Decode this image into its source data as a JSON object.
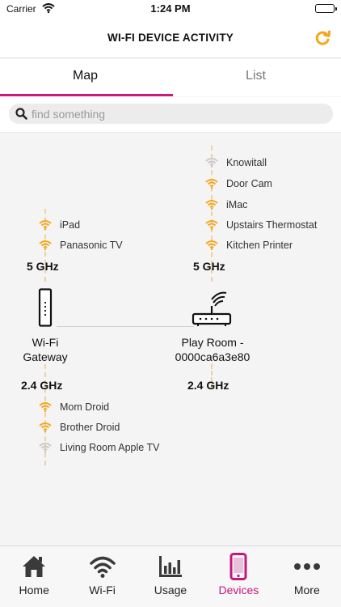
{
  "status": {
    "carrier": "Carrier",
    "time": "1:24 PM"
  },
  "header": {
    "title": "WI-FI DEVICE ACTIVITY"
  },
  "tabs": [
    {
      "label": "Map"
    },
    {
      "label": "List"
    }
  ],
  "search": {
    "placeholder": "find something"
  },
  "map": {
    "gateway": {
      "label_line1": "Wi-Fi",
      "label_line2": "Gateway",
      "band_5": "5 GHz",
      "band_24": "2.4 GHz",
      "devices_5": [
        "iPad",
        "Panasonic TV"
      ],
      "devices_24": [
        "Mom Droid",
        "Brother Droid",
        "Living Room Apple TV"
      ]
    },
    "extender": {
      "label_line1": "Play Room -",
      "label_line2": "0000ca6a3e80",
      "band_5": "5 GHz",
      "band_24": "2.4 GHz",
      "devices_5": [
        "Knowitall",
        "Door Cam",
        "iMac",
        "Upstairs Thermostat",
        "Kitchen Printer"
      ]
    }
  },
  "tabbar": [
    {
      "label": "Home",
      "icon": "home-icon"
    },
    {
      "label": "Wi-Fi",
      "icon": "wifi-icon"
    },
    {
      "label": "Usage",
      "icon": "bar-chart-icon"
    },
    {
      "label": "Devices",
      "icon": "phone-icon"
    },
    {
      "label": "More",
      "icon": "more-icon"
    }
  ],
  "colors": {
    "accent": "#c2187e",
    "signal": "#f2a81d",
    "signal_weak": "#c9c9c9",
    "refresh": "#f2a81d"
  }
}
